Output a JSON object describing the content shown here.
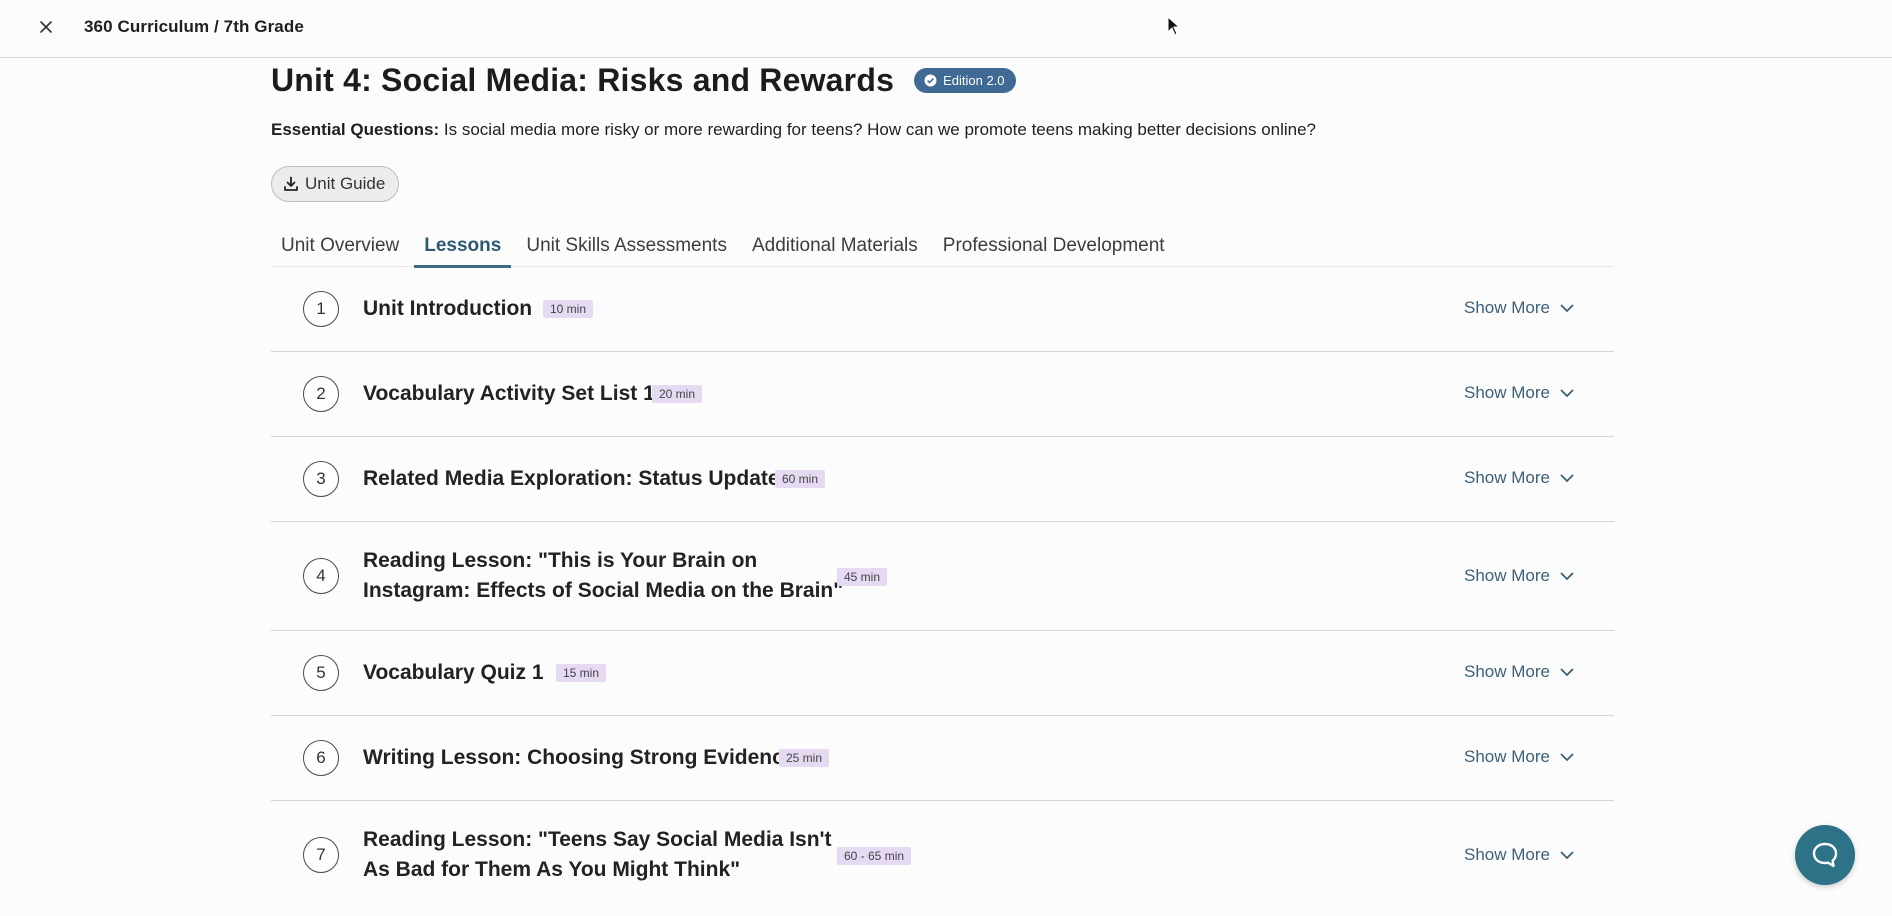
{
  "header": {
    "breadcrumb": "360 Curriculum / 7th Grade"
  },
  "unit": {
    "title": "Unit 4: Social Media: Risks and Rewards",
    "edition": "Edition 2.0",
    "essential_label": "Essential Questions:",
    "essential_text": " Is social media more risky or more rewarding for teens? How can we promote teens making better decisions online?",
    "guide_label": "Unit Guide"
  },
  "tabs": [
    {
      "label": "Unit Overview"
    },
    {
      "label": "Lessons"
    },
    {
      "label": "Unit Skills Assessments"
    },
    {
      "label": "Additional Materials"
    },
    {
      "label": "Professional Development"
    }
  ],
  "show_more_label": "Show More",
  "lessons": [
    {
      "num": "1",
      "title": "Unit Introduction",
      "duration": "10 min"
    },
    {
      "num": "2",
      "title": "Vocabulary Activity Set List 1",
      "duration": "20 min"
    },
    {
      "num": "3",
      "title": "Related Media Exploration: Status Update",
      "duration": "60 min"
    },
    {
      "num": "4",
      "title_line1": "Reading Lesson: \"This is Your Brain on",
      "title_line2": "Instagram: Effects of Social Media on the Brain\"",
      "duration": "45 min"
    },
    {
      "num": "5",
      "title": "Vocabulary Quiz 1",
      "duration": "15 min"
    },
    {
      "num": "6",
      "title": "Writing Lesson: Choosing Strong Evidence",
      "duration": "25 min"
    },
    {
      "num": "7",
      "title_line1": "Reading Lesson: \"Teens Say Social Media Isn't",
      "title_line2": "As Bad for Them As You Might Think\"",
      "duration": "60 - 65 min"
    }
  ],
  "colors": {
    "accent": "#3b6d86",
    "badge": "#3f6a94",
    "duration_bg": "#e6d9f2",
    "help_button": "#2d7286"
  }
}
